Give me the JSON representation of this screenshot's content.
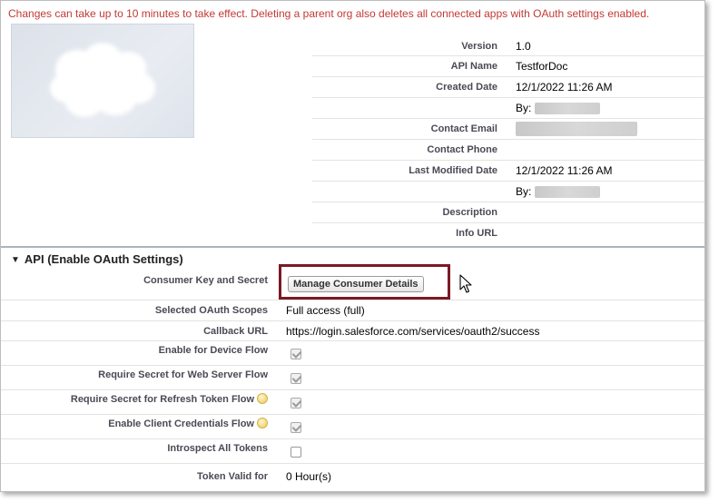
{
  "warning": "Changes can take up to 10 minutes to take effect. Deleting a parent org also deletes all connected apps with OAuth settings enabled.",
  "details": [
    {
      "label": "Version",
      "value": "1.0"
    },
    {
      "label": "API Name",
      "value": "TestforDoc"
    },
    {
      "label": "Created Date",
      "value": "12/1/2022 11:26 AM"
    },
    {
      "label": "",
      "value": "By:"
    },
    {
      "label": "Contact Email",
      "value": ""
    },
    {
      "label": "Contact Phone",
      "value": ""
    },
    {
      "label": "Last Modified Date",
      "value": "12/1/2022 11:26 AM"
    },
    {
      "label": "",
      "value": "By:"
    },
    {
      "label": "Description",
      "value": ""
    },
    {
      "label": "Info URL",
      "value": ""
    }
  ],
  "oauth_section": {
    "title": "API (Enable OAuth Settings)",
    "consumer_key_label": "Consumer Key and Secret",
    "manage_button": "Manage Consumer Details",
    "scopes_label": "Selected OAuth Scopes",
    "scopes_value": "Full access (full)",
    "callback_label": "Callback URL",
    "callback_value": "https://login.salesforce.com/services/oauth2/success",
    "device_flow_label": "Enable for Device Flow",
    "device_flow_checked": true,
    "web_server_label": "Require Secret for Web Server Flow",
    "web_server_checked": true,
    "refresh_label": "Require Secret for Refresh Token Flow",
    "refresh_checked": true,
    "client_cred_label": "Enable Client Credentials Flow",
    "client_cred_checked": true,
    "introspect_label": "Introspect All Tokens",
    "introspect_checked": false,
    "token_valid_label": "Token Valid for",
    "token_valid_value": "0 Hour(s)"
  },
  "colors": {
    "warning": "#c23934",
    "highlight_border": "#7a1a24",
    "section_rule": "#a8b4c2"
  },
  "icons": {
    "logo": "salesforce-cloud-logo",
    "help": "info-bubble-icon",
    "cursor": "mouse-pointer-icon"
  }
}
